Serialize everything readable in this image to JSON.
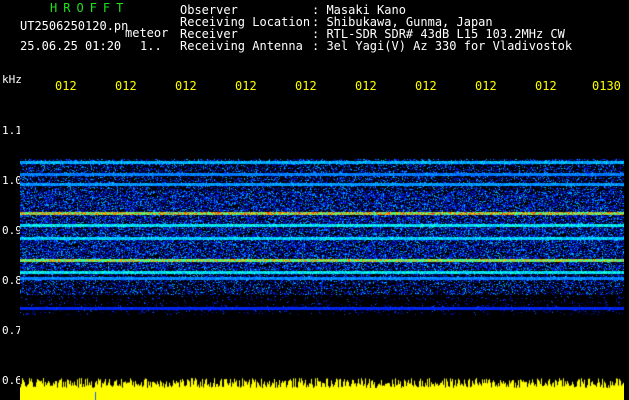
{
  "header": {
    "logo_text": "HROFFT",
    "file_name": "UT2506250120.pn",
    "mode": "meteor",
    "date_time": "25.06.25 01:20",
    "counter": "1..",
    "info": [
      {
        "label": "Observer",
        "value": ": Masaki Kano"
      },
      {
        "label": "Receiving Location",
        "value": ": Shibukawa, Gunma, Japan"
      },
      {
        "label": "Receiver",
        "value": ": RTL-SDR SDR# 43dB L15 103.2MHz CW"
      },
      {
        "label": "Receiving Antenna",
        "value": ": 3el Yagi(V) Az 330 for Vladivostok"
      }
    ]
  },
  "axes": {
    "unit": "kHz",
    "y_ticks": [
      "1.1",
      "1.0",
      "0.9",
      "0.8",
      "0.7",
      "0.6"
    ],
    "x_ticks": [
      "012",
      "012",
      "012",
      "012",
      "012",
      "012",
      "012",
      "012",
      "012",
      "0130"
    ]
  },
  "colors": {
    "background": "#000000",
    "title_green": "#1fe01f",
    "tick_yellow": "#ffff00",
    "noise_blue": "#0a3cff",
    "strong_red": "#ff2020",
    "mid_green": "#20ff60",
    "amplitude_yellow": "#ffff00"
  }
}
